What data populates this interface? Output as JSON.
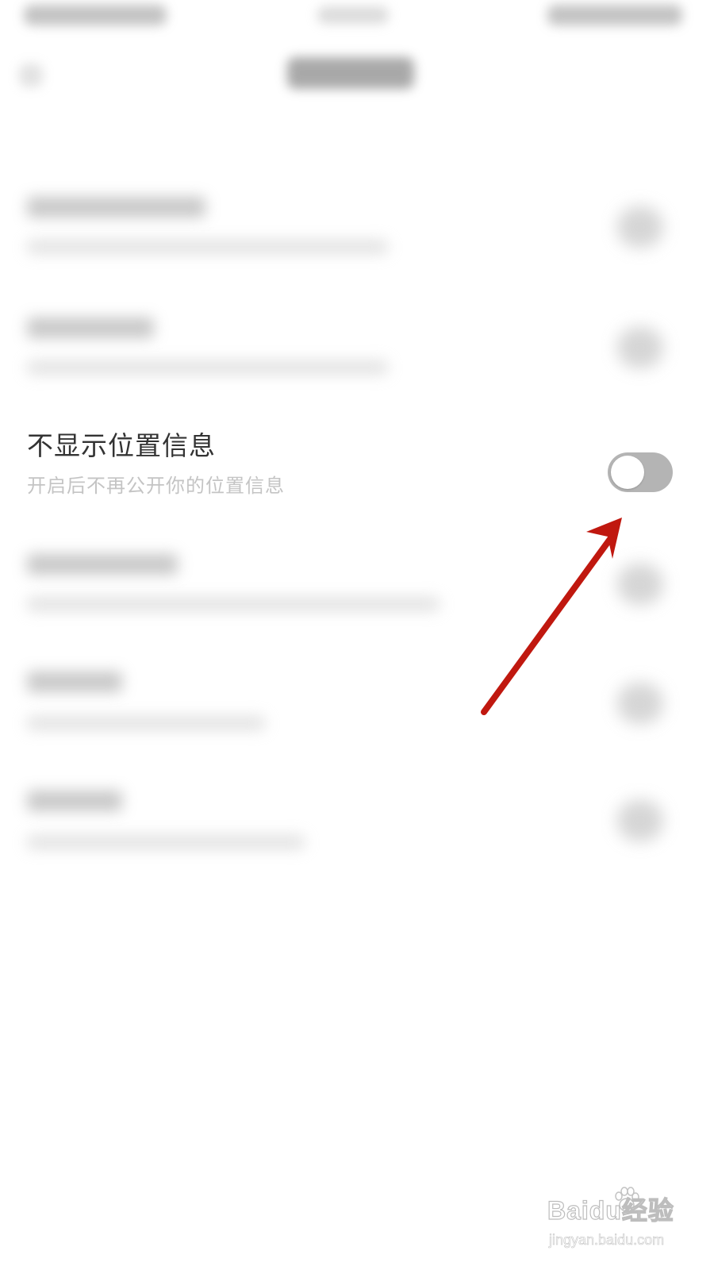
{
  "setting": {
    "title": "不显示位置信息",
    "description": "开启后不再公开你的位置信息",
    "toggle_on": false
  },
  "colors": {
    "toggle_track": "#b4b4b4",
    "toggle_knob": "#ffffff",
    "title_text": "#333333",
    "description_text": "#c4c4c4",
    "annotation_arrow": "#c0180f"
  },
  "watermark": {
    "logo": "Baidu经验",
    "url": "jingyan.baidu.com"
  }
}
